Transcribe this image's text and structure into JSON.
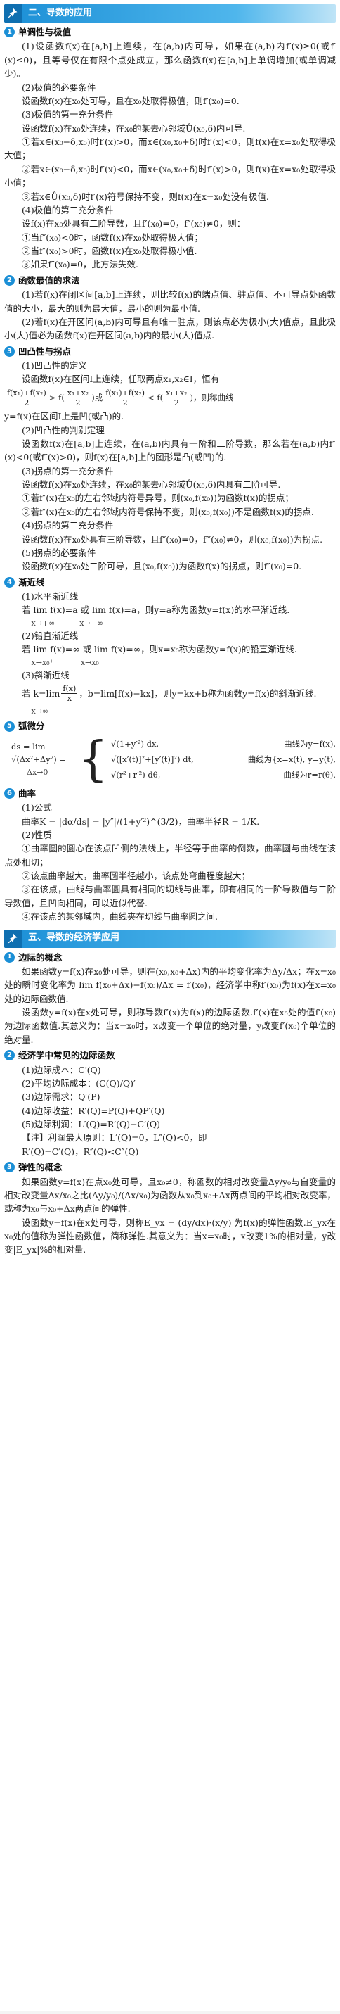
{
  "sections": {
    "s2_title": "二、导数的应用",
    "s5_title": "五、导数的经济学应用"
  },
  "s2": {
    "t1": "单调性与极值",
    "t1_p1": "(1)设函数f(x)在[a,b]上连续，在(a,b)内可导，如果在(a,b)内f′(x)≥0(或f′(x)≤0)，且等号仅在有限个点处成立，那么函数f(x)在[a,b]上单调增加(或单调减少)。",
    "t1_p2": "(2)极值的必要条件",
    "t1_p3": "设函数f(x)在x₀处可导，且在x₀处取得极值，则f′(x₀)=0.",
    "t1_p4": "(3)极值的第一充分条件",
    "t1_p5": "设函数f(x)在x₀处连续，在x₀的某去心邻域Ů(x₀,δ)内可导.",
    "t1_p6": "①若x∈(x₀−δ,x₀)时f′(x)>0，而x∈(x₀,x₀+δ)时f′(x)<0，则f(x)在x=x₀处取得极大值；",
    "t1_p7": "②若x∈(x₀−δ,x₀)时f′(x)<0，而x∈(x₀,x₀+δ)时f′(x)>0，则f(x)在x=x₀处取得极小值；",
    "t1_p8": "③若x∈Ů(x₀,δ)时f′(x)符号保持不变，则f(x)在x=x₀处没有极值.",
    "t1_p9": "(4)极值的第二充分条件",
    "t1_p10": "设f(x)在x₀处具有二阶导数，且f′(x₀)=0，f″(x₀)≠0，则：",
    "t1_p11": "①当f″(x₀)<0时，函数f(x)在x₀处取得极大值；",
    "t1_p12": "②当f″(x₀)>0时，函数f(x)在x₀处取得极小值.",
    "t1_p13": "③如果f″(x₀)=0，此方法失效.",
    "t2": "函数最值的求法",
    "t2_p1": "(1)若f(x)在闭区间[a,b]上连续，则比较f(x)的端点值、驻点值、不可导点处函数值的大小，最大的则为最大值，最小的则为最小值.",
    "t2_p2": "(2)若f(x)在开区间(a,b)内可导且有唯一驻点，则该点必为极小(大)值点，且此极小(大)值必为函数f(x)在开区间(a,b)内的最小(大)值点.",
    "t3": "凹凸性与拐点",
    "t3_p1": "(1)凹凸性的定义",
    "t3_p2": "设函数f(x)在区间I上连续，任取两点x₁,x₂∈I，恒有",
    "t3_f1a": "f(x₁)+f(x₂)",
    "t3_f1b": "2",
    "t3_f1c": "> f(",
    "t3_f1d": "x₁+x₂",
    "t3_f1e": "2",
    "t3_f1f": ")或",
    "t3_f1g": "f(x₁)+f(x₂)",
    "t3_f1h": "2",
    "t3_f1i": "< f(",
    "t3_f1j": "x₁+x₂",
    "t3_f1k": "2",
    "t3_f1l": ")，则称曲线",
    "t3_p3": "y=f(x)在区间I上是凹(或凸)的.",
    "t3_p4": "(2)凹凸性的判别定理",
    "t3_p5": "设函数f(x)在[a,b]上连续，在(a,b)内具有一阶和二阶导数，那么若在(a,b)内f″(x)<0(或f″(x)>0)，则f(x)在[a,b]上的图形是凸(或凹)的.",
    "t3_p6": "(3)拐点的第一充分条件",
    "t3_p7": "设函数f(x)在x₀处连续，在x₀的某去心邻域Ů(x₀,δ)内具有二阶可导.",
    "t3_p8": "①若f″(x)在x₀的左右邻域内符号异号，则(x₀,f(x₀))为函数f(x)的拐点；",
    "t3_p9": "②若f″(x)在x₀的左右邻域内符号保持不变，则(x₀,f(x₀))不是函数f(x)的拐点.",
    "t3_p10": "(4)拐点的第二充分条件",
    "t3_p11": "设函数f(x)在x₀处具有三阶导数，且f″(x₀)=0，f‴(x₀)≠0，则(x₀,f(x₀))为拐点.",
    "t3_p12": "(5)拐点的必要条件",
    "t3_p13": "设函数f(x)在x₀处二阶可导，且(x₀,f(x₀))为函数f(x)的拐点，则f″(x₀)=0.",
    "t4": "渐近线",
    "t4_p1": "(1)水平渐近线",
    "t4_p2": "若 lim f(x)=a 或 lim f(x)=a，则y=a称为函数y=f(x)的水平渐近线.",
    "t4_p2_sub1": "x→+∞",
    "t4_p2_sub2": "x→−∞",
    "t4_p3": "(2)铅直渐近线",
    "t4_p4": "若 lim f(x)=∞ 或 lim f(x)=∞，则x=x₀称为函数y=f(x)的铅直渐近线.",
    "t4_p4_sub1": "x→x₀⁺",
    "t4_p4_sub2": "x→x₀⁻",
    "t4_p5": "(3)斜渐近线",
    "t4_p6a": "若 k=lim",
    "t4_p6b": "f(x)",
    "t4_p6c": "x",
    "t4_p6d": "，b=lim[f(x)−kx]，则y=kx+b称为函数y=f(x)的斜渐近线.",
    "t4_p6_sub": "x→∞",
    "t5": "弧微分",
    "t5_ds": "ds = lim √(Δx²+Δy²) =",
    "t5_ds_sub": "Δx→0",
    "t5_r1a": "√(1+y′²) dx,",
    "t5_r1b": "曲线为y=f(x),",
    "t5_r2a": "√([x′(t)]²+[y′(t)]²) dt,",
    "t5_r2b": "曲线为{x=x(t), y=y(t),",
    "t5_r3a": "√(r²+r′²) dθ,",
    "t5_r3b": "曲线为r=r(θ).",
    "t6": "曲率",
    "t6_p1": "(1)公式",
    "t6_p2": "曲率K = |dα/ds| = |y″|/(1+y′²)^(3/2)，曲率半径R = 1/K.",
    "t6_p3": "(2)性质",
    "t6_p4": "①曲率圆的圆心在该点凹侧的法线上，半径等于曲率的倒数，曲率圆与曲线在该点处相切；",
    "t6_p5": "②该点曲率越大，曲率圆半径越小，该点处弯曲程度越大；",
    "t6_p6": "③在该点，曲线与曲率圆具有相同的切线与曲率，即有相同的一阶导数值与二阶导数值，且凹向相同，可以近似代替.",
    "t6_p7": "④在该点的某邻域内，曲线夹在切线与曲率圆之间."
  },
  "s5": {
    "t1": "边际的概念",
    "t1_p1": "如果函数y=f(x)在x₀处可导，则在(x₀,x₀+Δx)内的平均变化率为Δy/Δx；在x=x₀处的瞬时变化率为 lim f(x₀+Δx)−f(x₀)/Δx = f′(x₀)，经济学中称f′(x₀)为f(x)在x=x₀处的边际函数值.",
    "t1_p2": "设函数y=f(x)在x处可导，则称导数f′(x)为f(x)的边际函数.f′(x)在x₀处的值f′(x₀)为边际函数值.其意义为：当x=x₀时，x改变一个单位的绝对量，y改变f′(x₀)个单位的绝对量.",
    "t2": "经济学中常见的边际函数",
    "t2_p1": "(1)边际成本：C′(Q)",
    "t2_p2": "(2)平均边际成本：(C(Q)/Q)′",
    "t2_p3": "(3)边际需求：Q′(P)",
    "t2_p4": "(4)边际收益：R′(Q)=P(Q)+QP′(Q)",
    "t2_p5": "(5)边际利润：L′(Q)=R′(Q)−C′(Q)",
    "t2_p6": "【注】利润最大原则：L′(Q)=0，L″(Q)<0，即",
    "t2_p7": "R′(Q)=C′(Q)，R″(Q)<C″(Q)",
    "t3": "弹性的概念",
    "t3_p1": "如果函数y=f(x)在点x₀处可导，且x₀≠0，称函数的相对改变量Δy/y₀与自变量的相对改变量Δx/x₀之比(Δy/y₀)/(Δx/x₀)为函数从x₀到x₀+Δx两点间的平均相对改变率，或称为x₀与x₀+Δx两点间的弹性.",
    "t3_p2": "设函数y=f(x)在x处可导，则称E_yx = (dy/dx)·(x/y) 为f(x)的弹性函数.E_yx在x₀处的值称为弹性函数值，简称弹性.其意义为：当x=x₀时，x改变1%的相对量，y改变|E_yx|%的相对量."
  }
}
